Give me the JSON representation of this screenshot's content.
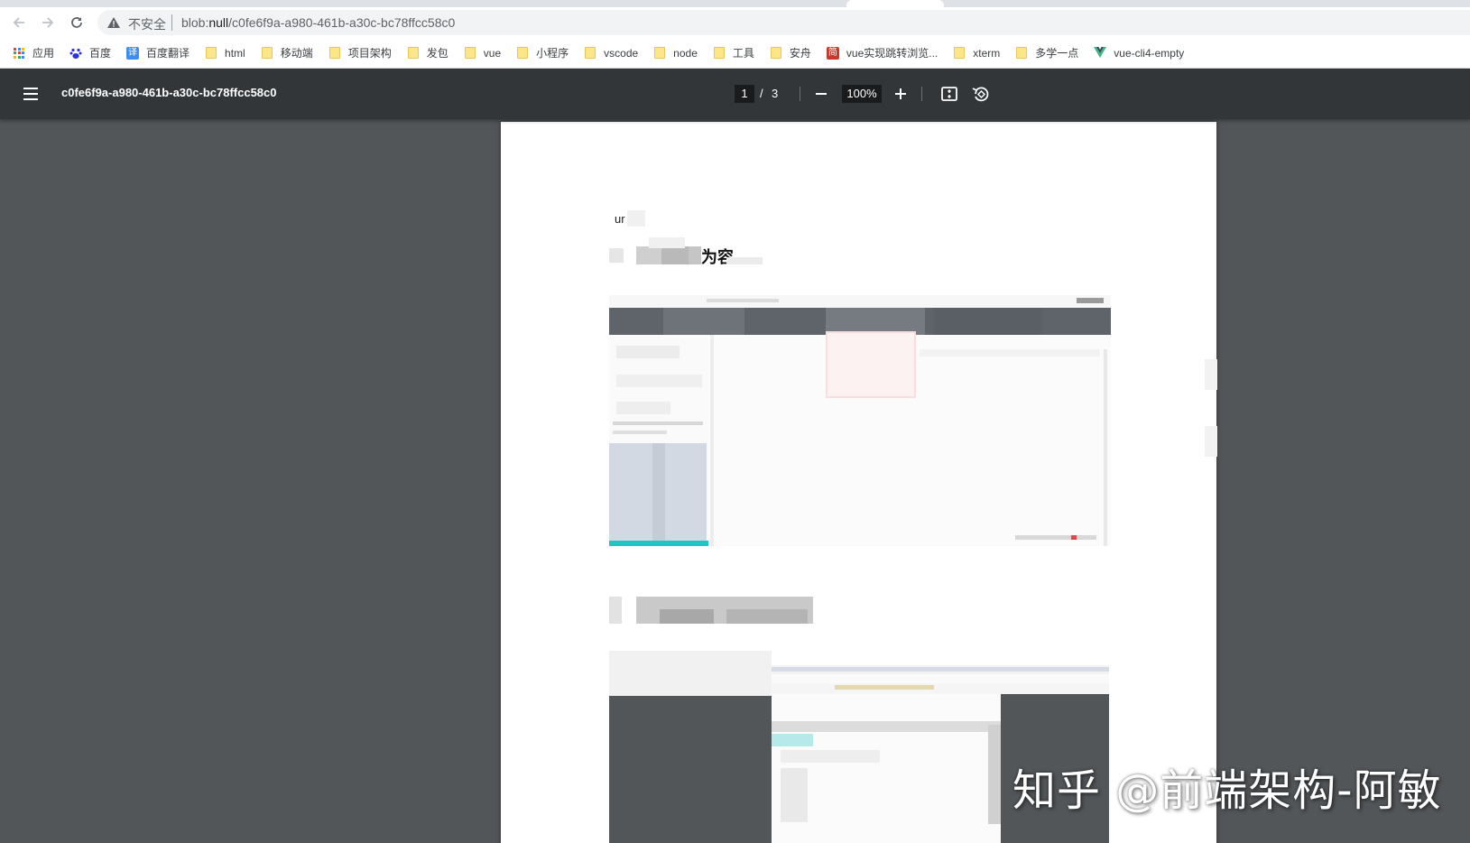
{
  "browser": {
    "insecure_label": "不安全",
    "url_prefix": "blob:",
    "url_host": "null",
    "url_path": "/c0fe6f9a-a980-461b-a30c-bc78ffcc58c0"
  },
  "bookmarks": [
    {
      "label": "应用",
      "icon": "apps-grid-icon"
    },
    {
      "label": "百度",
      "icon": "baidu-paw-icon"
    },
    {
      "label": "百度翻译",
      "icon": "fanyi-icon",
      "glyph": "译"
    },
    {
      "label": "html",
      "icon": "folder-icon"
    },
    {
      "label": "移动端",
      "icon": "folder-icon"
    },
    {
      "label": "项目架构",
      "icon": "folder-icon"
    },
    {
      "label": "发包",
      "icon": "folder-icon"
    },
    {
      "label": "vue",
      "icon": "folder-icon"
    },
    {
      "label": "小程序",
      "icon": "folder-icon"
    },
    {
      "label": "vscode",
      "icon": "folder-icon"
    },
    {
      "label": "node",
      "icon": "folder-icon"
    },
    {
      "label": "工具",
      "icon": "folder-icon"
    },
    {
      "label": "安舟",
      "icon": "folder-icon"
    },
    {
      "label": "vue实现跳转浏览...",
      "icon": "jian-icon",
      "glyph": "简"
    },
    {
      "label": "xterm",
      "icon": "folder-icon"
    },
    {
      "label": "多学一点",
      "icon": "folder-icon"
    },
    {
      "label": "vue-cli4-empty",
      "icon": "vue-logo-icon"
    }
  ],
  "pdf": {
    "title": "c0fe6f9a-a980-461b-a30c-bc78ffcc58c0",
    "page_current": "1",
    "page_separator": "/",
    "page_total": "3",
    "zoom": "100%",
    "snippet": "ur",
    "heading_fragment": "为容"
  },
  "watermark": "知乎 @前端架构-阿敏",
  "colors": {
    "pdf_toolbar": "#323639",
    "viewer_bg": "#525659",
    "page_bg": "#ffffff",
    "teal_accent": "#22c3c3"
  }
}
